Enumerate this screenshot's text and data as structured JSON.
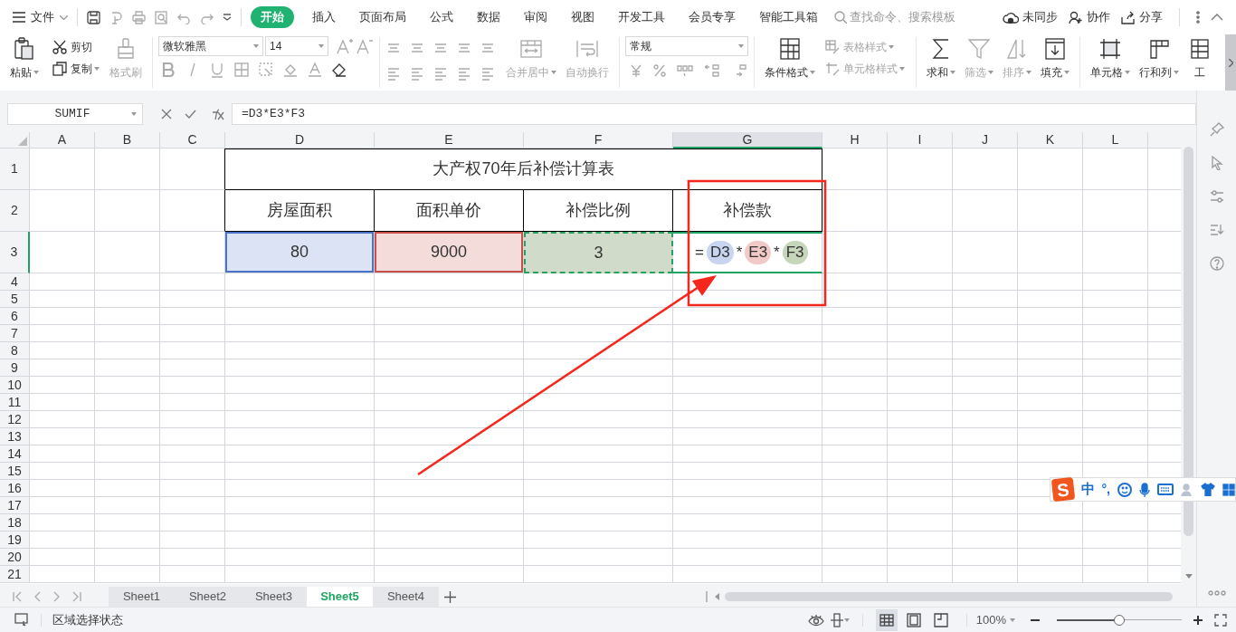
{
  "app_menu": {
    "label": "文件"
  },
  "ribbon_tabs": [
    {
      "label": "开始",
      "selected": true
    },
    {
      "label": "插入",
      "selected": false
    },
    {
      "label": "页面布局",
      "selected": false
    },
    {
      "label": "公式",
      "selected": false
    },
    {
      "label": "数据",
      "selected": false
    },
    {
      "label": "审阅",
      "selected": false
    },
    {
      "label": "视图",
      "selected": false
    },
    {
      "label": "开发工具",
      "selected": false
    },
    {
      "label": "会员专享",
      "selected": false
    },
    {
      "label": "智能工具箱",
      "selected": false
    }
  ],
  "search": {
    "placeholder": "查找命令、搜索模板"
  },
  "top_actions": [
    {
      "label": "未同步"
    },
    {
      "label": "协作"
    },
    {
      "label": "分享"
    }
  ],
  "ribbon": {
    "paste": {
      "label": "粘贴",
      "dropdown": true,
      "disabled": false
    },
    "cut": {
      "label": "剪切",
      "dropdown": false,
      "disabled": false
    },
    "copy": {
      "label": "复制",
      "dropdown": true,
      "disabled": false
    },
    "format_painter": {
      "label": "格式刷",
      "dropdown": false,
      "disabled": true
    },
    "font": {
      "value": "微软雅黑"
    },
    "font_size": {
      "value": "14"
    },
    "merge_center": {
      "label": "合并居中",
      "dropdown": true,
      "disabled": true
    },
    "wrap_text": {
      "label": "自动换行",
      "dropdown": false,
      "disabled": true
    },
    "number_format": {
      "value": "常规"
    },
    "conditional_format": {
      "label": "条件格式",
      "dropdown": true,
      "disabled": false
    },
    "table_style": {
      "label": "表格样式",
      "dropdown": true,
      "disabled": true
    },
    "cell_style": {
      "label": "单元格样式",
      "dropdown": true,
      "disabled": true
    },
    "sum": {
      "label": "求和",
      "dropdown": true,
      "disabled": false
    },
    "filter": {
      "label": "筛选",
      "dropdown": true,
      "disabled": true
    },
    "sort": {
      "label": "排序",
      "dropdown": true,
      "disabled": true
    },
    "fill": {
      "label": "填充",
      "dropdown": true,
      "disabled": false
    },
    "cells": {
      "label": "单元格",
      "dropdown": true,
      "disabled": false
    },
    "rows_columns": {
      "label": "行和列",
      "dropdown": true,
      "disabled": false
    },
    "worksheet": {
      "label": "工",
      "dropdown": false,
      "disabled": false
    }
  },
  "name_box": {
    "value": "SUMIF"
  },
  "formula_bar": {
    "value": "=D3*E3*F3"
  },
  "columns": [
    {
      "label": "A",
      "selected": false
    },
    {
      "label": "B",
      "selected": false
    },
    {
      "label": "C",
      "selected": false
    },
    {
      "label": "D",
      "selected": false
    },
    {
      "label": "E",
      "selected": false
    },
    {
      "label": "F",
      "selected": false
    },
    {
      "label": "G",
      "selected": true
    },
    {
      "label": "H",
      "selected": false
    },
    {
      "label": "I",
      "selected": false
    },
    {
      "label": "J",
      "selected": false
    },
    {
      "label": "K",
      "selected": false
    },
    {
      "label": "L",
      "selected": false
    }
  ],
  "rows": [
    {
      "label": "1",
      "selected": false
    },
    {
      "label": "2",
      "selected": false
    },
    {
      "label": "3",
      "selected": true
    },
    {
      "label": "4",
      "selected": false
    },
    {
      "label": "5",
      "selected": false
    },
    {
      "label": "6",
      "selected": false
    },
    {
      "label": "7",
      "selected": false
    },
    {
      "label": "8",
      "selected": false
    },
    {
      "label": "9",
      "selected": false
    },
    {
      "label": "10",
      "selected": false
    },
    {
      "label": "11",
      "selected": false
    },
    {
      "label": "12",
      "selected": false
    },
    {
      "label": "13",
      "selected": false
    },
    {
      "label": "14",
      "selected": false
    },
    {
      "label": "15",
      "selected": false
    },
    {
      "label": "16",
      "selected": false
    },
    {
      "label": "17",
      "selected": false
    },
    {
      "label": "18",
      "selected": false
    },
    {
      "label": "19",
      "selected": false
    },
    {
      "label": "20",
      "selected": false
    },
    {
      "label": "21",
      "selected": false
    }
  ],
  "table": {
    "title": "大产权70年后补偿计算表",
    "headers": [
      "房屋面积",
      "面积单价",
      "补偿比例",
      "补偿款"
    ],
    "values": [
      {
        "text": "80",
        "color": "#dce3f4",
        "marquee": false
      },
      {
        "text": "9000",
        "color": "#f4dcdb",
        "marquee": false
      },
      {
        "text": "3",
        "color": "#d0dcc9",
        "marquee": true
      }
    ],
    "formula_cell": {
      "active": true,
      "parts": [
        {
          "kind": "operator",
          "text": "="
        },
        {
          "kind": "ref",
          "text": "D3",
          "color": "#c7d5f0"
        },
        {
          "kind": "operator",
          "text": "*"
        },
        {
          "kind": "ref",
          "text": "E3",
          "color": "#f1c9c6"
        },
        {
          "kind": "operator",
          "text": "*"
        },
        {
          "kind": "ref",
          "text": "F3",
          "color": "#c5d6bb"
        }
      ]
    }
  },
  "sheets": [
    {
      "label": "Sheet1",
      "selected": false
    },
    {
      "label": "Sheet2",
      "selected": false
    },
    {
      "label": "Sheet3",
      "selected": false
    },
    {
      "label": "Sheet5",
      "selected": true
    },
    {
      "label": "Sheet4",
      "selected": false
    }
  ],
  "ime_toolbar": {
    "logo": "S",
    "items": [
      "中",
      "°,"
    ]
  },
  "status_bar": {
    "text": "区域选择状态",
    "zoom": "100%",
    "zoom_slider": {
      "level": 0.5
    },
    "views": [
      {
        "selected": true
      },
      {
        "selected": false
      },
      {
        "selected": false
      }
    ]
  }
}
